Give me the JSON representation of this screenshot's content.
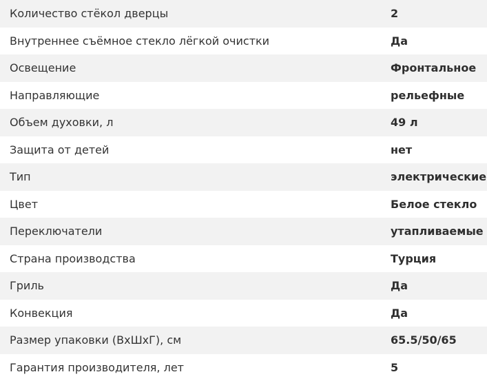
{
  "specs": [
    {
      "label": "Количество стёкол дверцы",
      "value": "2"
    },
    {
      "label": "Внутреннее съёмное стекло лёгкой очистки",
      "value": "Да"
    },
    {
      "label": "Освещение",
      "value": "Фронтальное"
    },
    {
      "label": "Направляющие",
      "value": "рельефные"
    },
    {
      "label": "Объем духовки, л",
      "value": "49 л"
    },
    {
      "label": "Защита от детей",
      "value": "нет"
    },
    {
      "label": "Тип",
      "value": "электрические"
    },
    {
      "label": "Цвет",
      "value": "Белое стекло"
    },
    {
      "label": "Переключатели",
      "value": "утапливаемые"
    },
    {
      "label": "Страна производства",
      "value": "Турция"
    },
    {
      "label": "Гриль",
      "value": "Да"
    },
    {
      "label": "Конвекция",
      "value": "Да"
    },
    {
      "label": "Размер упаковки (ВхШхГ), см",
      "value": "65.5/50/65"
    },
    {
      "label": "Гарантия производителя, лет",
      "value": "5"
    }
  ]
}
